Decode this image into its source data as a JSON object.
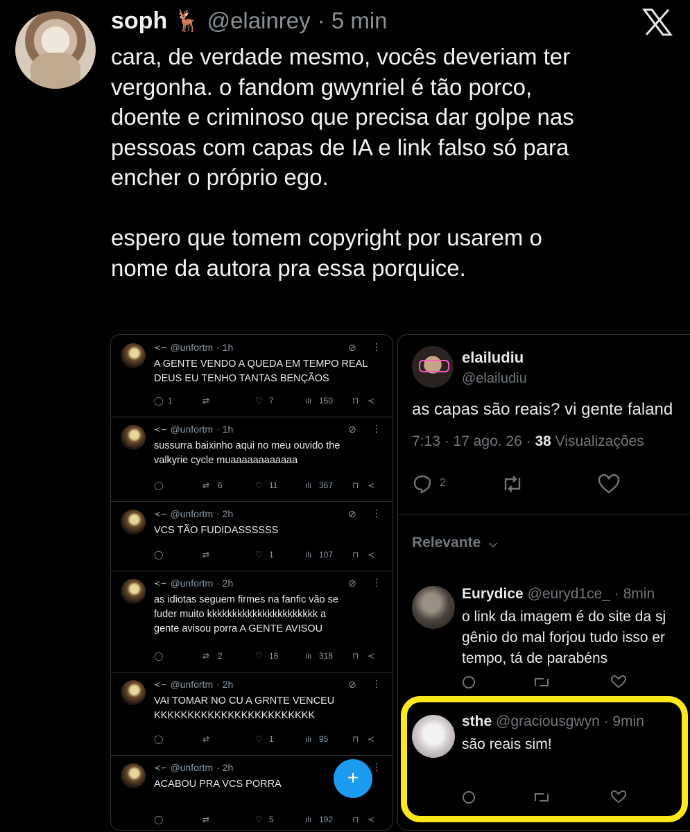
{
  "tweet": {
    "name": "soph",
    "name_emoji": "🦌",
    "handle": "@elainrey",
    "time": "· 5 min",
    "text": "cara, de verdade mesmo, vocês deveriam ter\nvergonha. o fandom gwynriel é tão porco,\ndoente e criminoso que precisa dar golpe nas\npessoas com capas de IA e link falso só para\nencher o próprio ego.\n\nespero que tomem copyright por usarem o\nnome da autora pra essa porquice."
  },
  "left_panel": {
    "fab_label": "+",
    "posts": [
      {
        "handle": "@unfortm",
        "time": "· 1h",
        "text": "A GENTE VENDO A QUEDA EM TEMPO REAL\nDEUS EU TENHO TANTAS BENÇÃOS",
        "replies": "1",
        "reposts": "",
        "likes": "7",
        "views": "150"
      },
      {
        "handle": "@unfortm",
        "time": "· 1h",
        "text": "sussurra baixinho aqui no meu ouvido the\nvalkyrie cycle muaaaaaaaaaaaa",
        "replies": "",
        "reposts": "6",
        "likes": "11",
        "views": "367"
      },
      {
        "handle": "@unfortm",
        "time": "· 2h",
        "text": "VCS TÃO FUDIDASSSSSS",
        "replies": "",
        "reposts": "",
        "likes": "1",
        "views": "107"
      },
      {
        "handle": "@unfortm",
        "time": "· 2h",
        "text": "as idiotas seguem firmes na fanfic vão se\nfuder muito kkkkkkkkkkkkkkkkkkkkkk a\ngente avisou porra A GENTE AVISOU",
        "replies": "",
        "reposts": "2",
        "likes": "16",
        "views": "318"
      },
      {
        "handle": "@unfortm",
        "time": "· 2h",
        "text": "VAI TOMAR NO CU A GRNTE VENCEU\nKKKKKKKKKKKKKKKKKKKKKKKK",
        "replies": "",
        "reposts": "",
        "likes": "1",
        "views": "95"
      },
      {
        "handle": "@unfortm",
        "time": "· 2h",
        "text": "ACABOU PRA VCS PORRA",
        "replies": "",
        "reposts": "",
        "likes": "5",
        "views": "192"
      }
    ]
  },
  "right_panel": {
    "name": "elailudiu",
    "handle": "@elailudiu",
    "text": "as capas são reais? vi gente faland",
    "time": "7:13 · 17 ago. 26 ·",
    "views_count": "38",
    "views_label": "Visualizações",
    "replies": "2",
    "sort_label": "Relevante",
    "replies_list": [
      {
        "name": "Eurydice",
        "handle": "@euryd1ce_",
        "time": "· 8min",
        "text": "o link da imagem é do site da sj\ngênio do mal forjou tudo isso er\ntempo, tá de parabéns"
      },
      {
        "name": "sthe",
        "handle": "@graciousgwyn",
        "time": "· 9min",
        "text": "são reais sim!"
      }
    ]
  },
  "colors": {
    "highlight": "#ffe81a",
    "fab": "#1d9bf0",
    "muted": "#71767b"
  }
}
